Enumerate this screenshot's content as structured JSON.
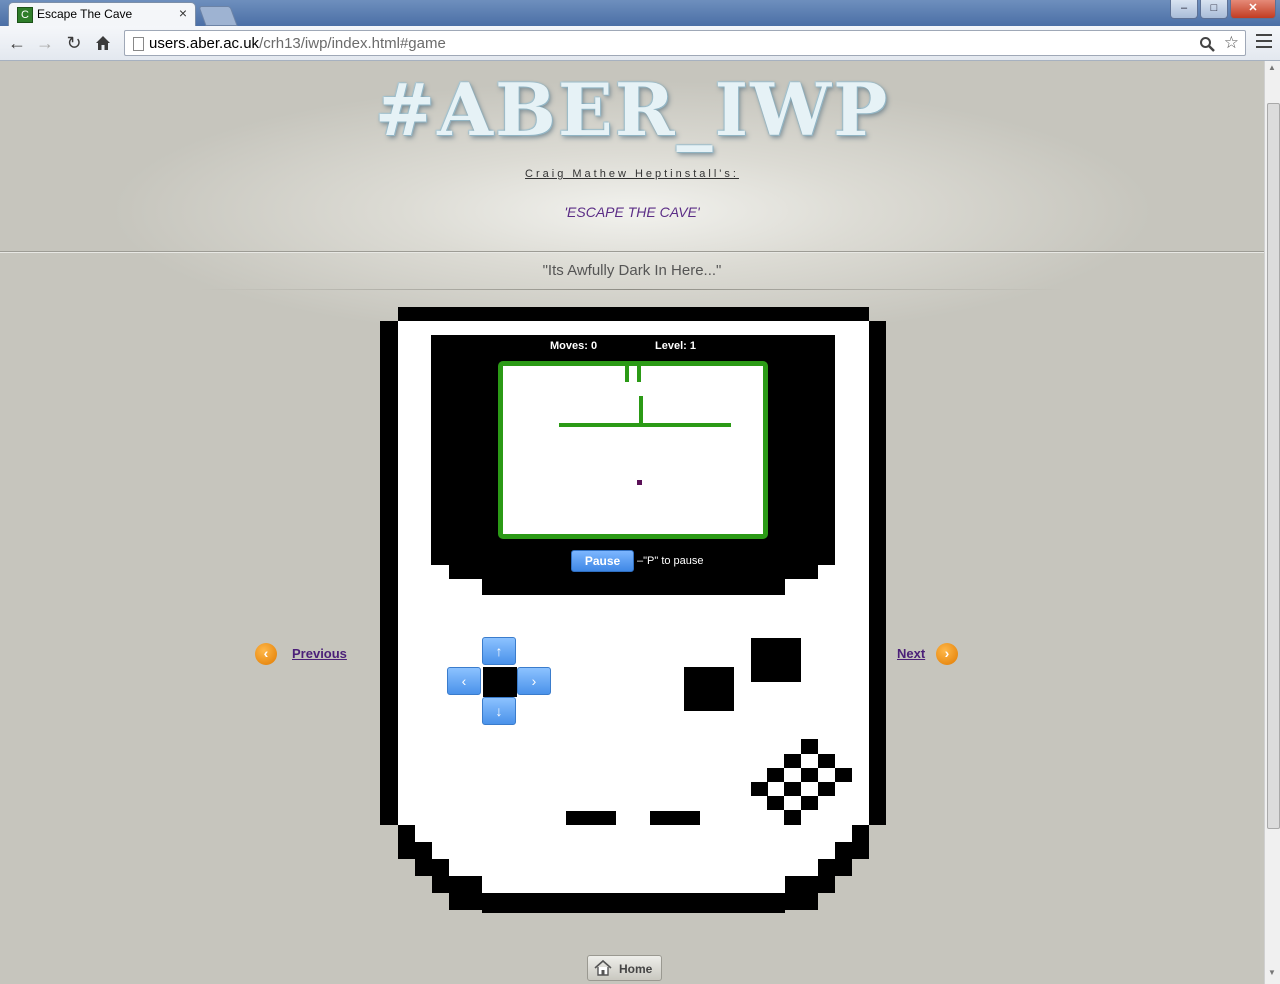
{
  "browser": {
    "tab_title": "Escape The Cave",
    "tab_favicon": "C",
    "tab_close": "×",
    "window_buttons": [
      "–",
      "□",
      "✕"
    ],
    "url_host": "users.aber.ac.uk",
    "url_path": "/crh13/iwp/index.html#game"
  },
  "header": {
    "logo": "#ABER_IWP",
    "author": "Craig Mathew Heptinstall's:",
    "game_title": "'ESCAPE THE CAVE'",
    "tagline": "\"Its Awfully Dark In Here...\""
  },
  "game": {
    "moves_label": "Moves: 0",
    "level_label": "Level: 1",
    "pause_button": "Pause",
    "pause_hint": "–\"P\" to pause",
    "dpad": {
      "up": "↑",
      "down": "↓",
      "left": "‹",
      "right": "›"
    }
  },
  "nav": {
    "previous": "Previous",
    "next": "Next",
    "home": "Home"
  },
  "colors": {
    "maze_wall": "#2b9a16",
    "link": "#4b1f78",
    "nav_circle": "#e07a00",
    "button_blue": "#4a92ea"
  }
}
